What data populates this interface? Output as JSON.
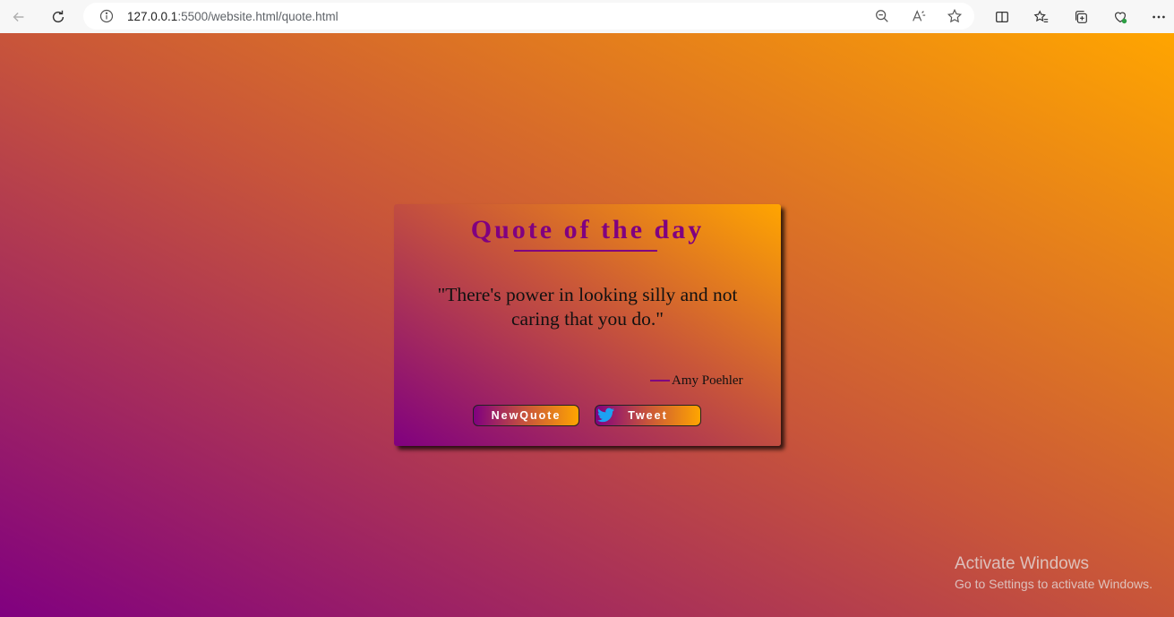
{
  "browser": {
    "url_host": "127.0.0.1",
    "url_rest": ":5500/website.html/quote.html",
    "icons": [
      "back-icon",
      "refresh-icon",
      "info-icon",
      "zoom-out-icon",
      "read-aloud-icon",
      "favorite-star-icon",
      "split-screen-icon",
      "favorites-list-icon",
      "collections-icon",
      "browser-essentials-icon",
      "more-options-icon"
    ]
  },
  "card": {
    "title": "Quote of the day",
    "quote": "\"There's power in looking silly and not caring that you do.\"",
    "author": "Amy Poehler",
    "new_quote_label": "NewQuote",
    "tweet_label": "Tweet"
  },
  "watermark": {
    "title": "Activate Windows",
    "subtitle": "Go to Settings to activate Windows."
  },
  "colors": {
    "accent_purple": "#800080",
    "gradient_orange": "#ffa500",
    "twitter_blue": "#1da1f2"
  }
}
